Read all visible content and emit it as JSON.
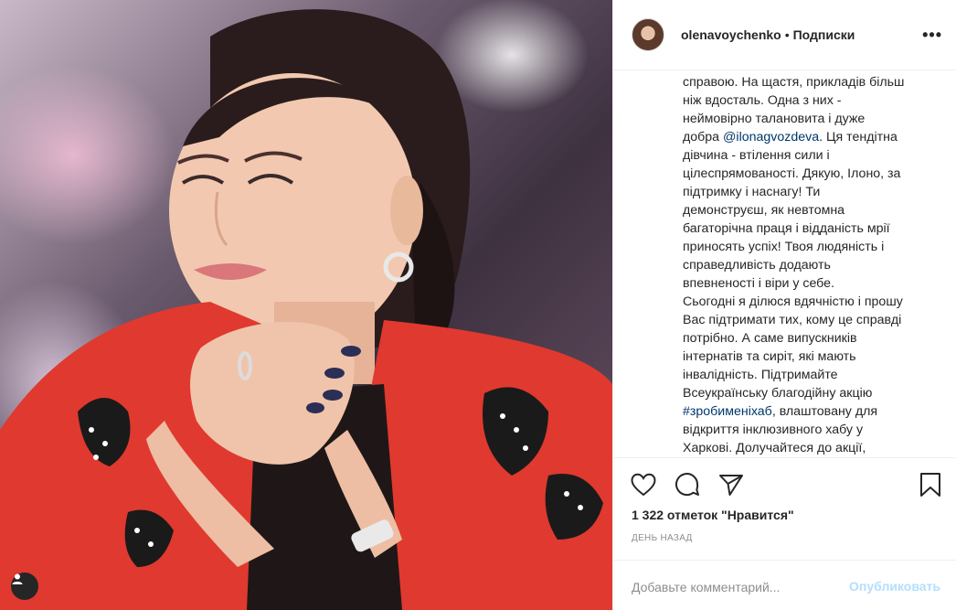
{
  "post": {
    "image_alt": "Photo of a smiling woman in a red jacket resting her chin on her folded hands"
  },
  "header": {
    "username": "olenavoychenko",
    "separator": "•",
    "follow_label": "Подписки",
    "more_label": "•••"
  },
  "caption": {
    "lines": [
      "справою. На щастя, прикладів більш",
      "ніж вдосталь. Одна з них -",
      "неймовірно талановита і дуже",
      "добра ",
      "@ilonagvozdeva",
      ". Ця тендітна",
      "дівчина - втілення сили і",
      "цілеспрямованості. Дякую, Ілоно, за",
      "підтримку і наснагу! Ти",
      "демонструєш, як невтомна",
      "багаторічна праця і відданість мрії",
      "приносять успіх! Твоя людяність і",
      "справедливість додають",
      "впевненості і віри у себе.",
      "Сьогодні я ділюся вдячністю і прошу",
      "Вас підтримати тих, кому це справді",
      "потрібно. А саме випускників",
      "інтернатів та сиріт, які мають",
      "інвалідність. Підтримайте",
      "Всеукраїнську благодійну акцію",
      "#зробименіхаб",
      ", влаштовану для",
      "відкриття інклюзивного хабу у",
      "Харкові. Долучайтеся до акції,"
    ]
  },
  "actions": {
    "like_icon": "heart-icon",
    "comment_icon": "comment-icon",
    "share_icon": "share-icon",
    "save_icon": "bookmark-icon"
  },
  "likes_text": "1 322 отметок \"Нравится\"",
  "time_text": "ДЕНЬ НАЗАД",
  "comment": {
    "placeholder": "Добавьте комментарий...",
    "value": "",
    "publish_label": "Опубликовать"
  },
  "colors": {
    "link": "#00376b",
    "publish_disabled": "#b2dffc",
    "muted": "#8e8e8e",
    "text": "#262626"
  }
}
